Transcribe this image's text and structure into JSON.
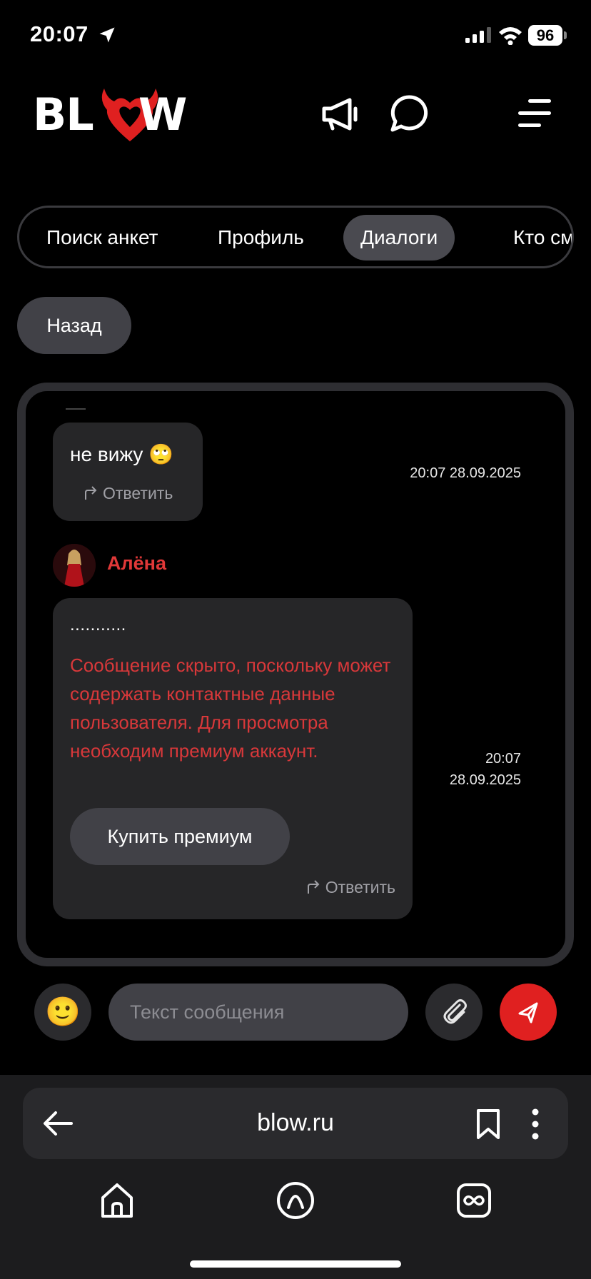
{
  "status_bar": {
    "time": "20:07",
    "battery": "96"
  },
  "header": {
    "logo_left": "BL",
    "logo_right": "W",
    "icons": [
      "megaphone-icon",
      "chat-bubble-icon",
      "menu-icon"
    ]
  },
  "tabs": [
    {
      "label": "Поиск анкет",
      "active": false
    },
    {
      "label": "Профиль",
      "active": false
    },
    {
      "label": "Диалоги",
      "active": true
    },
    {
      "label": "Кто смотрел",
      "active": false
    }
  ],
  "back_button": "Назад",
  "chat": {
    "messages": [
      {
        "text": "не вижу",
        "emoji": "🙄",
        "reply_label": "Ответить",
        "timestamp": "20:07 28.09.2025"
      },
      {
        "sender": "Алёна",
        "masked_text": "...........",
        "hidden_notice": "Сообщение скрыто, поскольку может содержать контактные данные пользователя. Для просмотра необходим премиум аккаунт.",
        "premium_button": "Купить премиум",
        "reply_label": "Ответить",
        "timestamp_time": "20:07",
        "timestamp_date": "28.09.2025"
      }
    ]
  },
  "composer": {
    "emoji": "🙂",
    "placeholder": "Текст сообщения"
  },
  "browser": {
    "url": "blow.ru",
    "nav_icons": [
      "home-icon",
      "alice-icon",
      "tabs-icon"
    ]
  },
  "colors": {
    "accent_red": "#e02020",
    "hidden_text_red": "#d8383a",
    "sender_red": "#e03838",
    "background": "#000000"
  }
}
